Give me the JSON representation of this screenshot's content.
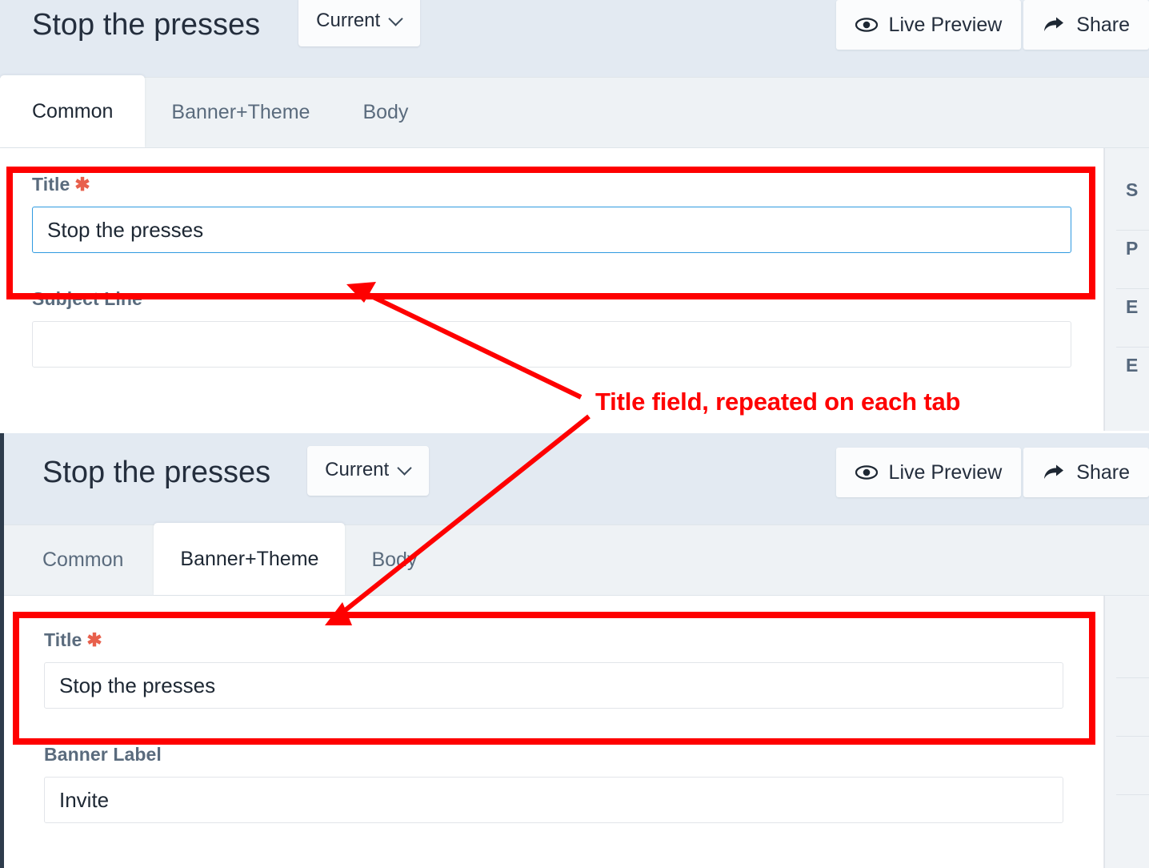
{
  "panels": [
    {
      "id": "top",
      "header": {
        "doc_title": "Stop the presses",
        "version_selector": {
          "label": "Current",
          "icon": "chevron-down-icon"
        },
        "actions": [
          {
            "label": "Live Preview",
            "icon": "eye-icon"
          },
          {
            "label": "Share",
            "icon": "share-arrow-icon"
          }
        ]
      },
      "tabs": [
        {
          "label": "Common",
          "active": true
        },
        {
          "label": "Banner+Theme",
          "active": false
        },
        {
          "label": "Body",
          "active": false
        }
      ],
      "fields": [
        {
          "label": "Title",
          "required": true,
          "value": "Stop the presses",
          "placeholder": "",
          "focused": true
        },
        {
          "label": "Subject Line",
          "required": false,
          "value": "",
          "placeholder": "",
          "focused": false
        }
      ],
      "sidebar": [
        "S",
        "P",
        "E",
        "E"
      ]
    },
    {
      "id": "bottom",
      "header": {
        "doc_title": "Stop the presses",
        "version_selector": {
          "label": "Current",
          "icon": "chevron-down-icon"
        },
        "actions": [
          {
            "label": "Live Preview",
            "icon": "eye-icon"
          },
          {
            "label": "Share",
            "icon": "share-arrow-icon"
          }
        ]
      },
      "tabs": [
        {
          "label": "Common",
          "active": false
        },
        {
          "label": "Banner+Theme",
          "active": true
        },
        {
          "label": "Body",
          "active": false
        }
      ],
      "fields": [
        {
          "label": "Title",
          "required": true,
          "value": "Stop the presses",
          "placeholder": "",
          "focused": false
        },
        {
          "label": "Banner Label",
          "required": false,
          "value": "Invite",
          "placeholder": "",
          "focused": false
        }
      ],
      "sidebar": [
        "",
        "",
        "",
        ""
      ]
    }
  ],
  "annotation": {
    "text": "Title field, repeated on each tab",
    "color": "#fe0000"
  },
  "colors": {
    "header_bg": "#e3eaf2",
    "tabstrip_bg": "#eef2f5",
    "active_tab_bg": "#ffffff",
    "focus_border": "#2f9ae0",
    "required_asterisk": "#e8604c",
    "annotation_red": "#fe0000",
    "label_text": "#5a6b7d",
    "sidebar_bg": "#f0f3f6"
  }
}
